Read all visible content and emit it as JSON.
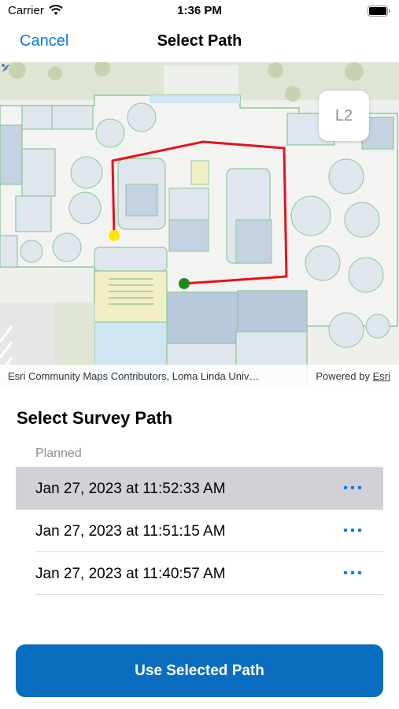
{
  "status_bar": {
    "carrier": "Carrier",
    "time": "1:36 PM",
    "icons": [
      "wifi-icon",
      "battery-icon"
    ]
  },
  "nav": {
    "cancel_label": "Cancel",
    "title": "Select Path"
  },
  "map": {
    "floor_label": "L2",
    "attribution": "Esri Community Maps Contributors, Loma Linda Univ…",
    "powered_by_prefix": "Powered by",
    "powered_by_link": "Esri",
    "path_color": "#e6121b",
    "start_marker_color": "#ffe600",
    "end_marker_color": "#1a8c1a"
  },
  "survey": {
    "title": "Select Survey Path",
    "section_header": "Planned",
    "paths": [
      {
        "label": "Jan 27, 2023 at 11:52:33 AM",
        "selected": true
      },
      {
        "label": "Jan 27, 2023 at 11:51:15 AM",
        "selected": false
      },
      {
        "label": "Jan 27, 2023 at 11:40:57 AM",
        "selected": false
      }
    ]
  },
  "primary_button": {
    "label": "Use Selected Path",
    "color": "#0a6dbf"
  },
  "colors": {
    "accent": "#0a7ae6",
    "selected_row": "#d1d1d6"
  }
}
